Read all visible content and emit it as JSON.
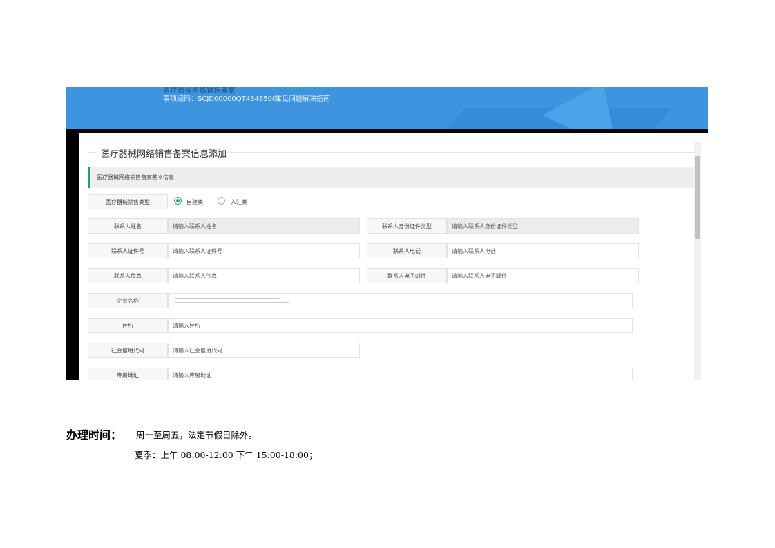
{
  "banner": {
    "title": "医疗器械网络销售备案",
    "code": "事项编码：SCJD00000QT48465001",
    "guide_link": "常见问题解决指南"
  },
  "form": {
    "section_title": "医疗器械网络销售备案信息添加",
    "subheader": "医疗器械网络销售备案基本信息",
    "sales_type": {
      "label": "医疗器械销售类型",
      "options": [
        "自建类",
        "入驻类"
      ],
      "selected": "自建类"
    },
    "fields": {
      "contact_name": {
        "label": "联系人姓名",
        "placeholder": "请输入联系人姓名"
      },
      "contact_id_type": {
        "label": "联系人身份证件类型",
        "placeholder": "请输入联系人身份证件类型"
      },
      "contact_id_no": {
        "label": "联系人证件号",
        "placeholder": "请输入联系人证件号"
      },
      "contact_phone": {
        "label": "联系人电话",
        "placeholder": "请输入联系人电话"
      },
      "contact_fax": {
        "label": "联系人传真",
        "placeholder": "请输入联系人传真"
      },
      "contact_email": {
        "label": "联系人电子邮件",
        "placeholder": "请输入联系人电子邮件"
      },
      "company_name": {
        "label": "企业名称"
      },
      "address": {
        "label": "住所",
        "placeholder": "请输入住所"
      },
      "credit_code": {
        "label": "社会信用代码",
        "placeholder": "请输入社会信用代码"
      },
      "warehouse": {
        "label": "库房地址",
        "placeholder": "请输入库房地址"
      }
    }
  },
  "hours": {
    "label": "办理时间：",
    "value": "周一至周五，法定节假日除外。",
    "summer": "夏季：上午 08:00-12:00 下午  15:00-18:00；"
  }
}
